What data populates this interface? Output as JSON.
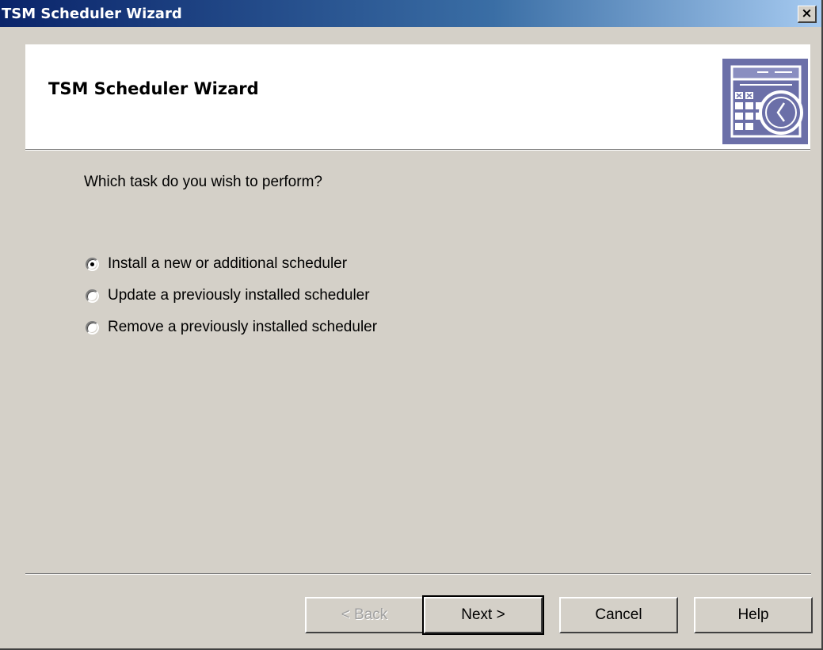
{
  "window": {
    "title": "TSM Scheduler Wizard",
    "close_label": "×"
  },
  "header": {
    "heading": "TSM Scheduler Wizard",
    "icon": "calendar-clock-icon"
  },
  "main": {
    "question": "Which task do you wish to perform?",
    "options": [
      {
        "label": "Install a new or additional scheduler",
        "checked": true
      },
      {
        "label": "Update a previously installed scheduler",
        "checked": false
      },
      {
        "label": "Remove a previously installed scheduler",
        "checked": false
      }
    ]
  },
  "buttons": {
    "back": "< Back",
    "next": "Next >",
    "cancel": "Cancel",
    "help": "Help"
  },
  "colors": {
    "titlebar_start": "#0a246a",
    "titlebar_end": "#a6caf0",
    "face": "#d4d0c8",
    "icon_bg": "#6b6fa8"
  }
}
